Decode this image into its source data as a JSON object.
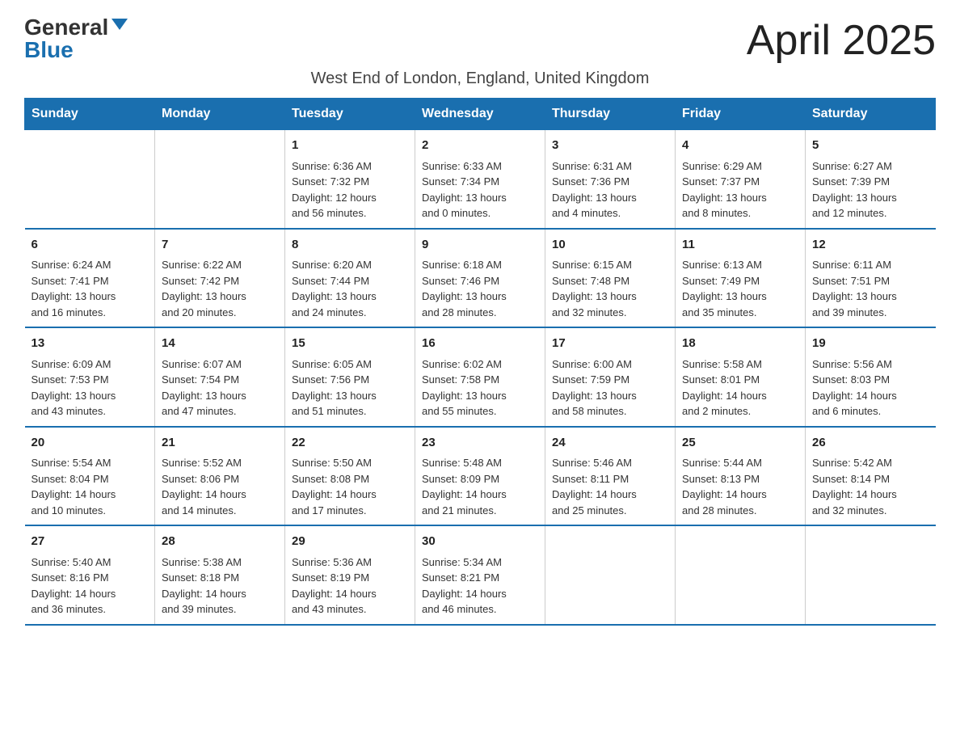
{
  "header": {
    "logo_general": "General",
    "logo_blue": "Blue",
    "month_title": "April 2025",
    "subtitle": "West End of London, England, United Kingdom"
  },
  "days_of_week": [
    "Sunday",
    "Monday",
    "Tuesday",
    "Wednesday",
    "Thursday",
    "Friday",
    "Saturday"
  ],
  "weeks": [
    [
      {
        "day": "",
        "info": ""
      },
      {
        "day": "",
        "info": ""
      },
      {
        "day": "1",
        "info": "Sunrise: 6:36 AM\nSunset: 7:32 PM\nDaylight: 12 hours\nand 56 minutes."
      },
      {
        "day": "2",
        "info": "Sunrise: 6:33 AM\nSunset: 7:34 PM\nDaylight: 13 hours\nand 0 minutes."
      },
      {
        "day": "3",
        "info": "Sunrise: 6:31 AM\nSunset: 7:36 PM\nDaylight: 13 hours\nand 4 minutes."
      },
      {
        "day": "4",
        "info": "Sunrise: 6:29 AM\nSunset: 7:37 PM\nDaylight: 13 hours\nand 8 minutes."
      },
      {
        "day": "5",
        "info": "Sunrise: 6:27 AM\nSunset: 7:39 PM\nDaylight: 13 hours\nand 12 minutes."
      }
    ],
    [
      {
        "day": "6",
        "info": "Sunrise: 6:24 AM\nSunset: 7:41 PM\nDaylight: 13 hours\nand 16 minutes."
      },
      {
        "day": "7",
        "info": "Sunrise: 6:22 AM\nSunset: 7:42 PM\nDaylight: 13 hours\nand 20 minutes."
      },
      {
        "day": "8",
        "info": "Sunrise: 6:20 AM\nSunset: 7:44 PM\nDaylight: 13 hours\nand 24 minutes."
      },
      {
        "day": "9",
        "info": "Sunrise: 6:18 AM\nSunset: 7:46 PM\nDaylight: 13 hours\nand 28 minutes."
      },
      {
        "day": "10",
        "info": "Sunrise: 6:15 AM\nSunset: 7:48 PM\nDaylight: 13 hours\nand 32 minutes."
      },
      {
        "day": "11",
        "info": "Sunrise: 6:13 AM\nSunset: 7:49 PM\nDaylight: 13 hours\nand 35 minutes."
      },
      {
        "day": "12",
        "info": "Sunrise: 6:11 AM\nSunset: 7:51 PM\nDaylight: 13 hours\nand 39 minutes."
      }
    ],
    [
      {
        "day": "13",
        "info": "Sunrise: 6:09 AM\nSunset: 7:53 PM\nDaylight: 13 hours\nand 43 minutes."
      },
      {
        "day": "14",
        "info": "Sunrise: 6:07 AM\nSunset: 7:54 PM\nDaylight: 13 hours\nand 47 minutes."
      },
      {
        "day": "15",
        "info": "Sunrise: 6:05 AM\nSunset: 7:56 PM\nDaylight: 13 hours\nand 51 minutes."
      },
      {
        "day": "16",
        "info": "Sunrise: 6:02 AM\nSunset: 7:58 PM\nDaylight: 13 hours\nand 55 minutes."
      },
      {
        "day": "17",
        "info": "Sunrise: 6:00 AM\nSunset: 7:59 PM\nDaylight: 13 hours\nand 58 minutes."
      },
      {
        "day": "18",
        "info": "Sunrise: 5:58 AM\nSunset: 8:01 PM\nDaylight: 14 hours\nand 2 minutes."
      },
      {
        "day": "19",
        "info": "Sunrise: 5:56 AM\nSunset: 8:03 PM\nDaylight: 14 hours\nand 6 minutes."
      }
    ],
    [
      {
        "day": "20",
        "info": "Sunrise: 5:54 AM\nSunset: 8:04 PM\nDaylight: 14 hours\nand 10 minutes."
      },
      {
        "day": "21",
        "info": "Sunrise: 5:52 AM\nSunset: 8:06 PM\nDaylight: 14 hours\nand 14 minutes."
      },
      {
        "day": "22",
        "info": "Sunrise: 5:50 AM\nSunset: 8:08 PM\nDaylight: 14 hours\nand 17 minutes."
      },
      {
        "day": "23",
        "info": "Sunrise: 5:48 AM\nSunset: 8:09 PM\nDaylight: 14 hours\nand 21 minutes."
      },
      {
        "day": "24",
        "info": "Sunrise: 5:46 AM\nSunset: 8:11 PM\nDaylight: 14 hours\nand 25 minutes."
      },
      {
        "day": "25",
        "info": "Sunrise: 5:44 AM\nSunset: 8:13 PM\nDaylight: 14 hours\nand 28 minutes."
      },
      {
        "day": "26",
        "info": "Sunrise: 5:42 AM\nSunset: 8:14 PM\nDaylight: 14 hours\nand 32 minutes."
      }
    ],
    [
      {
        "day": "27",
        "info": "Sunrise: 5:40 AM\nSunset: 8:16 PM\nDaylight: 14 hours\nand 36 minutes."
      },
      {
        "day": "28",
        "info": "Sunrise: 5:38 AM\nSunset: 8:18 PM\nDaylight: 14 hours\nand 39 minutes."
      },
      {
        "day": "29",
        "info": "Sunrise: 5:36 AM\nSunset: 8:19 PM\nDaylight: 14 hours\nand 43 minutes."
      },
      {
        "day": "30",
        "info": "Sunrise: 5:34 AM\nSunset: 8:21 PM\nDaylight: 14 hours\nand 46 minutes."
      },
      {
        "day": "",
        "info": ""
      },
      {
        "day": "",
        "info": ""
      },
      {
        "day": "",
        "info": ""
      }
    ]
  ]
}
